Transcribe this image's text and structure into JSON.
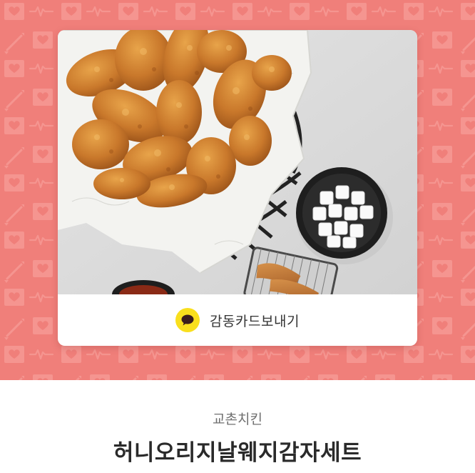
{
  "gift_card": {
    "send_label": "감동카드보내기",
    "icon": "kakao-talk-bubble-icon",
    "accent_color": "#F9DF1D"
  },
  "banner": {
    "background_color": "#F07F7A",
    "pattern_icons": [
      "heart-envelope-icon",
      "heartbeat-line-icon",
      "arrow-icon"
    ]
  },
  "product": {
    "brand": "교촌치킨",
    "name": "허니오리지날웨지감자세트"
  }
}
